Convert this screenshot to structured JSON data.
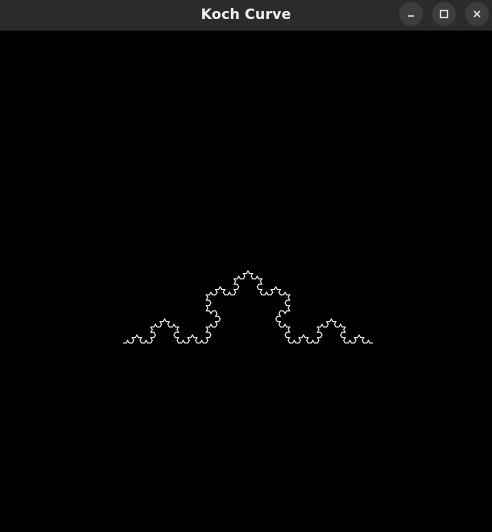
{
  "window": {
    "title": "Koch Curve",
    "buttons": [
      "minimize",
      "maximize",
      "close"
    ]
  },
  "canvas": {
    "background": "#000000",
    "stroke_color": "#ffffff",
    "fractal": "koch-curve",
    "iterations": 4
  }
}
